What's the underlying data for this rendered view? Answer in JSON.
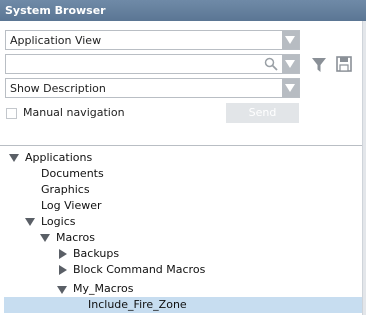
{
  "window": {
    "title": "System Browser"
  },
  "view_select": {
    "value": "Application View"
  },
  "search": {
    "value": ""
  },
  "description_select": {
    "value": "Show Description"
  },
  "manual_navigation": {
    "label": "Manual navigation",
    "checked": false
  },
  "send_button": {
    "label": "Send"
  },
  "icons": {
    "search": "search-icon",
    "filter": "filter-icon",
    "save": "save-icon",
    "dropdown": "chevron-down-icon",
    "expanded": "triangle-down-icon",
    "collapsed": "triangle-right-icon"
  },
  "colors": {
    "titlebar": "#5b7694",
    "selection": "#c7ddf0",
    "toolbar_icon": "#8a9097"
  },
  "tree": {
    "nodes": [
      {
        "label": "Applications",
        "state": "expanded"
      },
      {
        "label": "Documents",
        "state": "leaf"
      },
      {
        "label": "Graphics",
        "state": "leaf"
      },
      {
        "label": "Log Viewer",
        "state": "leaf"
      },
      {
        "label": "Logics",
        "state": "expanded"
      },
      {
        "label": "Macros",
        "state": "expanded"
      },
      {
        "label": "Backups",
        "state": "collapsed"
      },
      {
        "label": "Block Command Macros",
        "state": "collapsed"
      },
      {
        "label": "My_Macros",
        "state": "expanded"
      },
      {
        "label": "Include_Fire_Zone",
        "state": "leaf",
        "selected": true
      }
    ]
  }
}
